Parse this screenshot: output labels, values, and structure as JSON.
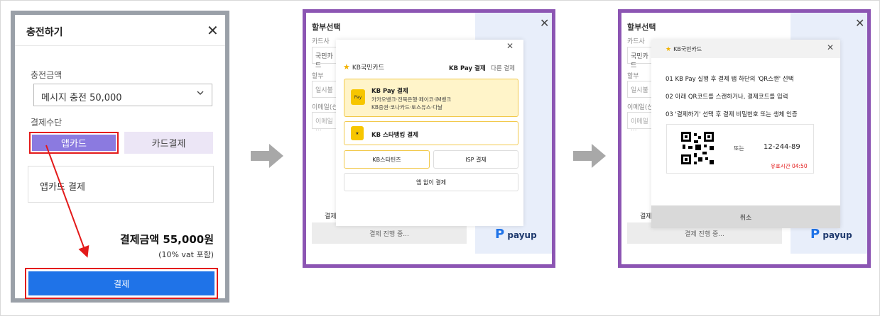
{
  "panel1": {
    "title": "충전하기",
    "close": "✕",
    "amount_label": "충전금액",
    "amount_value": "메시지 충전 50,000",
    "method_label": "결제수단",
    "btn_appcard": "앱카드",
    "btn_card": "카드결제",
    "appcard_box": "앱카드 결제",
    "total": "결제금액 55,000원",
    "vat": "(10% vat 포함)",
    "pay": "결제"
  },
  "panel2": {
    "bg_title": "할부선택",
    "bg_card_label": "카드사",
    "bg_card_value": "국민카드",
    "bg_install_label": "할부",
    "bg_install_value": "일시불",
    "bg_email_label": "이메일(선택",
    "bg_email_placeholder": "이메일 ...",
    "bg_submit_label": "결제",
    "bg_progress": "결제 진행 중...",
    "brand": "payup",
    "kb_brand": "KB국민카드",
    "tab_kbpay": "KB Pay 결제",
    "tab_other": "다른 결제",
    "opt1_title": "KB Pay 결제",
    "opt1_sub1": "카카오뱅크·전북은행·페이코·iM뱅크",
    "opt1_sub2": "KB증권·코나카드·토스유스·다날",
    "opt2_title": "KB 스타뱅킹 결제",
    "opt3": "KB스타틴즈",
    "opt4": "ISP 결제",
    "opt5": "앱 없이 결제",
    "pay_icon": "Pay"
  },
  "panel3": {
    "bg_title": "할부선택",
    "bg_card_label": "카드사",
    "bg_card_value": "국민카드",
    "bg_install_label": "할부",
    "bg_install_value": "일시불",
    "bg_email_label": "이메일(선택",
    "bg_email_placeholder": "이메일 ...",
    "bg_submit_label": "결제",
    "bg_progress": "결제 진행 중...",
    "brand": "payup",
    "kb_brand": "KB국민카드",
    "step1": "01   KB Pay 실행 후 결제 탭 하단의 'QR스캔' 선택",
    "step2": "02   아래 QR코드를 스캔하거나, 결제코드를 입력",
    "step3": "03   '결제하기' 선택 후 결제 비밀번호 또는 생체 인증",
    "or": "또는",
    "code": "12-244-89",
    "timer": "유효시간 04:50",
    "cancel": "취소"
  },
  "colors": {
    "accent_purple": "#8b7ae0",
    "pay_blue": "#1f73e8",
    "highlight_red": "#e31a1a",
    "frame_purple": "#8c55b3"
  }
}
